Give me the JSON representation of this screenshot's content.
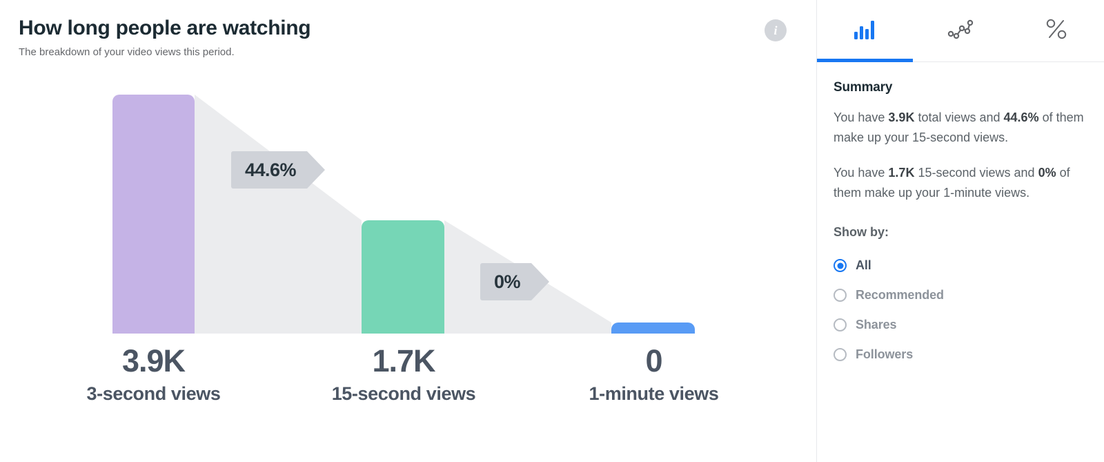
{
  "header": {
    "title": "How long people are watching",
    "subtitle": "The breakdown of your video views this period.",
    "info_icon": "info-icon",
    "info_glyph": "i"
  },
  "chart_data": {
    "type": "bar",
    "title": "How long people are watching",
    "subtitle": "The breakdown of your video views this period.",
    "xlabel": "",
    "ylabel": "",
    "grid": false,
    "legend": "none",
    "ylim": [
      0,
      3900
    ],
    "categories": [
      "3-second views",
      "15-second views",
      "1-minute views"
    ],
    "values": [
      3900,
      1700,
      0
    ],
    "value_labels": [
      "3.9K",
      "1.7K",
      "0"
    ],
    "bar_colors": [
      "#c5b3e6",
      "#76d6b6",
      "#589bf5"
    ],
    "funnel_step_labels": [
      "44.6%",
      "0%"
    ],
    "funnel_step_values": [
      44.6,
      0
    ],
    "funnel_fill_color": "#ebecee",
    "badge_color": "#cfd2d8"
  },
  "columns": [
    {
      "value": "3.9K",
      "name": "3-second views"
    },
    {
      "value": "1.7K",
      "name": "15-second views"
    },
    {
      "value": "0",
      "name": "1-minute views"
    }
  ],
  "badges": [
    {
      "label": "44.6%"
    },
    {
      "label": "0%"
    }
  ],
  "side_panel": {
    "tabs": [
      {
        "icon": "bar-chart-icon",
        "active": true
      },
      {
        "icon": "line-chart-icon",
        "active": false
      },
      {
        "icon": "percent-icon",
        "active": false
      }
    ],
    "summary_heading": "Summary",
    "summary_paragraphs": [
      {
        "parts": [
          {
            "text": "You have ",
            "bold": false
          },
          {
            "text": "3.9K",
            "bold": true
          },
          {
            "text": " total views and ",
            "bold": false
          },
          {
            "text": "44.6%",
            "bold": true
          },
          {
            "text": " of them make up your 15-second views.",
            "bold": false
          }
        ]
      },
      {
        "parts": [
          {
            "text": "You have ",
            "bold": false
          },
          {
            "text": "1.7K",
            "bold": true
          },
          {
            "text": " 15-second views and ",
            "bold": false
          },
          {
            "text": "0%",
            "bold": true
          },
          {
            "text": " of them make up your 1-minute views.",
            "bold": false
          }
        ]
      }
    ],
    "show_by_label": "Show by:",
    "show_by_options": [
      {
        "label": "All",
        "selected": true
      },
      {
        "label": "Recommended",
        "selected": false
      },
      {
        "label": "Shares",
        "selected": false
      },
      {
        "label": "Followers",
        "selected": false
      }
    ]
  },
  "colors": {
    "accent": "#1877f2",
    "bar_1": "#c5b3e6",
    "bar_2": "#76d6b6",
    "bar_3": "#589bf5",
    "funnel": "#ebecee",
    "badge": "#cfd2d8",
    "title": "#1c2b33",
    "muted": "#65676b"
  }
}
